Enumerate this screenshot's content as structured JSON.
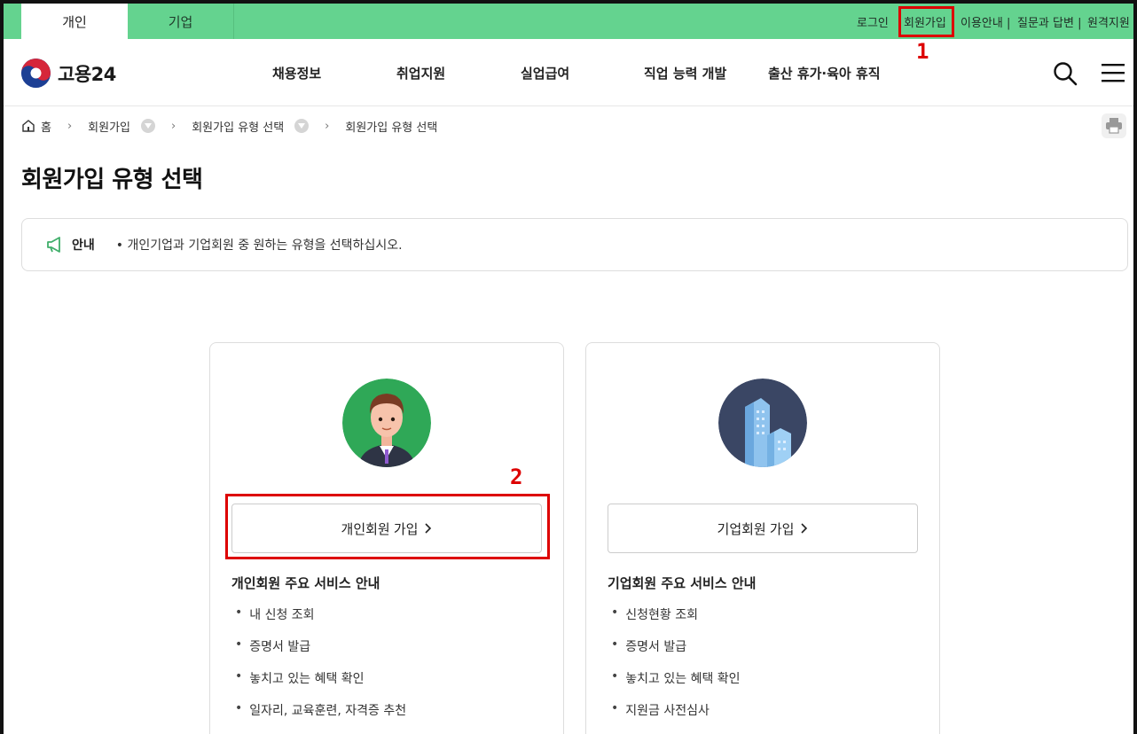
{
  "top_tabs": {
    "personal": "개인",
    "company": "기업"
  },
  "utility_links": {
    "login": "로그인",
    "join": "회원가입",
    "guide": "이용안내 |",
    "qa": "질문과 답변 |",
    "remote": "원격지원"
  },
  "logo": {
    "text": "고용24"
  },
  "gnb": [
    "채용정보",
    "취업지원",
    "실업급여",
    "직업 능력 개발",
    "출산 휴가·육아 휴직"
  ],
  "breadcrumb": {
    "home": "홈",
    "item1": "회원가입",
    "item2": "회원가입 유형 선택",
    "item3": "회원가입 유형 선택"
  },
  "page_title": "회원가입 유형 선택",
  "notice": {
    "label": "안내",
    "text": "• 개인기업과 기업회원 중 원하는 유형을 선택하십시오."
  },
  "cards": {
    "personal": {
      "button": "개인회원 가입",
      "services_title": "개인회원 주요 서비스 안내",
      "services": [
        "내 신청 조회",
        "증명서 발급",
        "놓치고 있는 혜택 확인",
        "일자리, 교육훈련, 자격증 추천"
      ]
    },
    "company": {
      "button": "기업회원 가입",
      "services_title": "기업회원 주요 서비스 안내",
      "services": [
        "신청현황 조회",
        "증명서 발급",
        "놓치고 있는 혜택 확인",
        "지원금 사전심사"
      ]
    }
  },
  "annotations": {
    "one": "1",
    "two": "2"
  },
  "colors": {
    "topbar": "#64d38f",
    "annotation": "#dd0000"
  }
}
